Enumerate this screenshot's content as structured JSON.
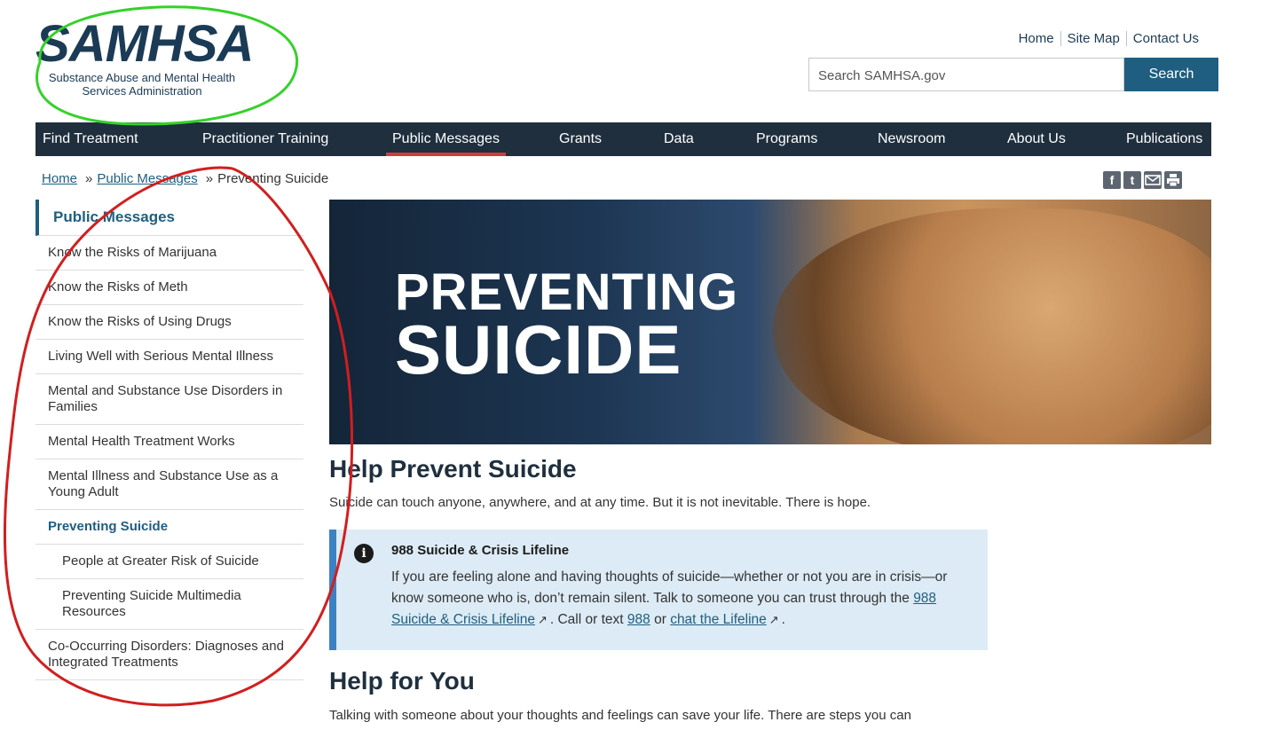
{
  "header": {
    "logo_word": "SAMHSA",
    "logo_sub_line1": "Substance Abuse and Mental Health",
    "logo_sub_line2": "Services Administration",
    "util_links": [
      "Home",
      "Site Map",
      "Contact Us"
    ],
    "search_placeholder": "Search SAMHSA.gov",
    "search_button": "Search"
  },
  "nav": {
    "items": [
      "Find Treatment",
      "Practitioner Training",
      "Public Messages",
      "Grants",
      "Data",
      "Programs",
      "Newsroom",
      "About Us",
      "Publications"
    ],
    "active": "Public Messages"
  },
  "breadcrumb": {
    "home": "Home",
    "sep": "»",
    "public_messages": "Public Messages",
    "current": "Preventing Suicide"
  },
  "share_icons": [
    "facebook-icon",
    "twitter-icon",
    "email-icon",
    "print-icon"
  ],
  "sidebar": {
    "title": "Public Messages",
    "items": [
      "Know the Risks of Marijuana",
      "Know the Risks of Meth",
      "Know the Risks of Using Drugs",
      "Living Well with Serious Mental Illness",
      "Mental and Substance Use Disorders in Families",
      "Mental Health Treatment Works",
      "Mental Illness and Substance Use as a Young Adult",
      "Preventing Suicide",
      "People at Greater Risk of Suicide",
      "Preventing Suicide Multimedia Resources",
      "Co-Occurring Disorders: Diagnoses and Integrated Treatments"
    ]
  },
  "hero": {
    "line1": "PREVENTING",
    "line2": "SUICIDE"
  },
  "content": {
    "heading": "Help Prevent Suicide",
    "intro": "Suicide can touch anyone, anywhere, and at any time. But it is not inevitable. There is hope.",
    "callout": {
      "icon": "info-icon",
      "title": "988 Suicide & Crisis Lifeline",
      "text1": "If you are feeling alone and having thoughts of suicide—whether or not you are in crisis—or know someone who is, don’t remain silent. Talk to someone you can trust through the",
      "link1": "988 Suicide & Crisis Lifeline",
      "text2": ". Call or text",
      "link2": "988",
      "text3": "or",
      "link3": "chat the Lifeline",
      "text4": "."
    },
    "heading2": "Help for You",
    "para2": "Talking with someone about your thoughts and feelings can save your life. There are steps you can"
  },
  "colors": {
    "nav_bg": "#1f2f3e",
    "accent_blue": "#1f5e80",
    "active_underline": "#d23b3b",
    "callout_bg": "#dcebf5",
    "callout_border": "#3c82c2",
    "annotation_green": "#35d12a",
    "annotation_red": "#d21e1e"
  }
}
